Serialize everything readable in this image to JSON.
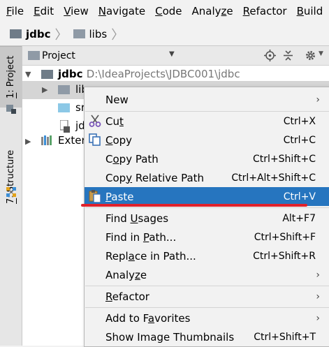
{
  "menubar": {
    "items": [
      {
        "pre": "",
        "key": "F",
        "post": "ile"
      },
      {
        "pre": "",
        "key": "E",
        "post": "dit"
      },
      {
        "pre": "",
        "key": "V",
        "post": "iew"
      },
      {
        "pre": "",
        "key": "N",
        "post": "avigate"
      },
      {
        "pre": "",
        "key": "C",
        "post": "ode"
      },
      {
        "pre": "Analy",
        "key": "z",
        "post": "e"
      },
      {
        "pre": "",
        "key": "R",
        "post": "efactor"
      },
      {
        "pre": "",
        "key": "B",
        "post": "uild"
      }
    ]
  },
  "breadcrumb": {
    "items": [
      "jdbc",
      "libs"
    ]
  },
  "toolstrip": {
    "project_tab": {
      "pre": "",
      "key": "1",
      "post": ": Project"
    },
    "structure_tab": {
      "pre": "",
      "key": "7",
      "post": ": Structure"
    }
  },
  "panel": {
    "title": "Project"
  },
  "tree": {
    "root_name": "jdbc",
    "root_path": "D:\\IdeaProjects\\JDBC001\\jdbc",
    "libs_label": "lib",
    "src_label": "sr",
    "iml_label": "jd",
    "external_label": "Exter"
  },
  "menu": {
    "items": [
      {
        "pre": "New",
        "key": "",
        "post": "",
        "shortcut": "",
        "sub": "›"
      },
      {
        "pre": "Cu",
        "key": "t",
        "post": "",
        "shortcut": "Ctrl+X",
        "sub": ""
      },
      {
        "pre": "",
        "key": "C",
        "post": "opy",
        "shortcut": "Ctrl+C",
        "sub": ""
      },
      {
        "pre": "C",
        "key": "o",
        "post": "py Path",
        "shortcut": "Ctrl+Shift+C",
        "sub": ""
      },
      {
        "pre": "Cop",
        "key": "y",
        "post": " Relative Path",
        "shortcut": "Ctrl+Alt+Shift+C",
        "sub": ""
      },
      {
        "pre": "",
        "key": "P",
        "post": "aste",
        "shortcut": "Ctrl+V",
        "sub": ""
      },
      {
        "pre": "Find ",
        "key": "U",
        "post": "sages",
        "shortcut": "Alt+F7",
        "sub": ""
      },
      {
        "pre": "Find in ",
        "key": "P",
        "post": "ath...",
        "shortcut": "Ctrl+Shift+F",
        "sub": ""
      },
      {
        "pre": "Repl",
        "key": "a",
        "post": "ce in Path...",
        "shortcut": "Ctrl+Shift+R",
        "sub": ""
      },
      {
        "pre": "Analy",
        "key": "z",
        "post": "e",
        "shortcut": "",
        "sub": "›"
      },
      {
        "pre": "",
        "key": "R",
        "post": "efactor",
        "shortcut": "",
        "sub": "›"
      },
      {
        "pre": "Add to F",
        "key": "a",
        "post": "vorites",
        "shortcut": "",
        "sub": "›"
      },
      {
        "pre": "Show Image Thumbnails",
        "key": "",
        "post": "",
        "shortcut": "Ctrl+Shift+T",
        "sub": ""
      }
    ]
  },
  "colors": {
    "selection": "#2675bf",
    "annotation": "#e0212b"
  }
}
